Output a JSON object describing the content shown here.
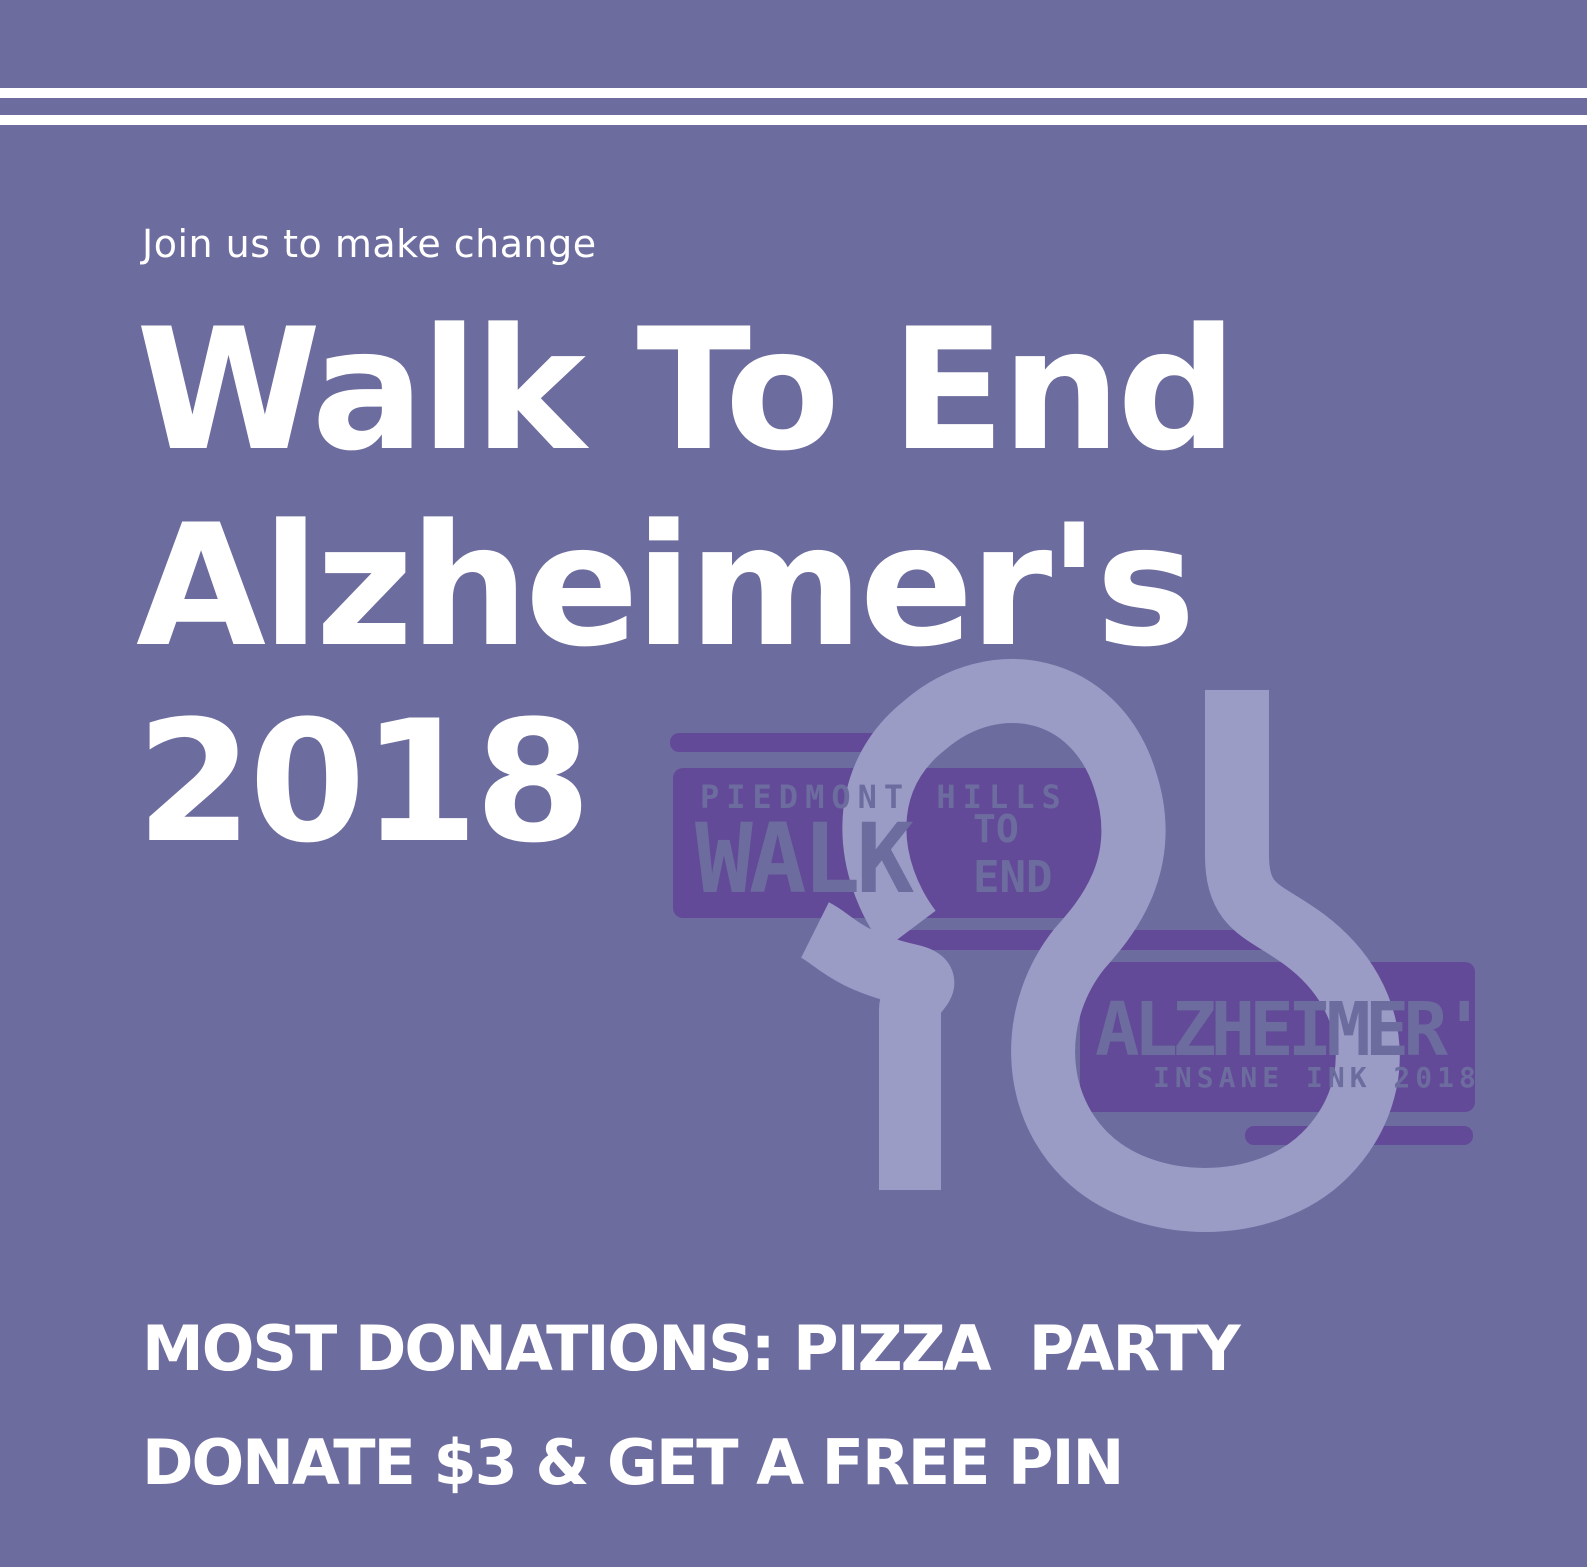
{
  "poster": {
    "tagline": "Join us to make change",
    "title_lines": [
      "Walk To End",
      "Alzheimer's",
      "2018"
    ],
    "promo_lines": [
      "MOST DONATIONS: PIZZA  PARTY",
      "DONATE $3 & GET A FREE PIN"
    ]
  },
  "logo": {
    "top_label": "PIEDMONT HILLS",
    "walk_word": "WALK",
    "to_word": "TO",
    "end_word": "END",
    "alz_word": "ALZHEIMER'S",
    "sub_label": "INSANE INK 2018"
  },
  "colors": {
    "background": "#6d6c9f",
    "text": "#ffffff",
    "logo_band": "#634a98",
    "logo_mark": "#9b9cc6"
  }
}
